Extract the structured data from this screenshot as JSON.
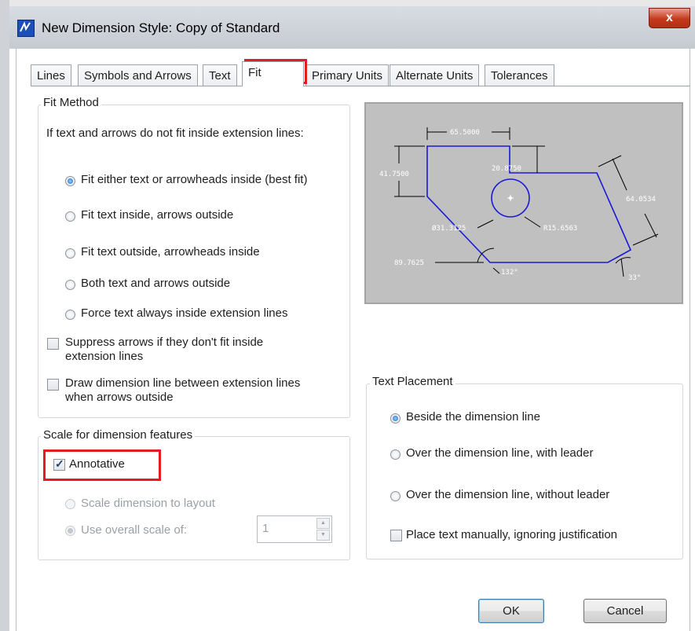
{
  "window": {
    "title": "New Dimension Style: Copy of Standard",
    "close_label": "x"
  },
  "tabs": [
    "Lines",
    "Symbols and Arrows",
    "Text",
    "Fit",
    "Primary Units",
    "Alternate Units",
    "Tolerances"
  ],
  "active_tab": "Fit",
  "fit_method": {
    "title": "Fit Method",
    "description": "If text and arrows do not fit inside extension lines:",
    "options": [
      {
        "label": "Fit either text or arrowheads inside (best fit)",
        "selected": true
      },
      {
        "label": "Fit text inside, arrows outside",
        "selected": false
      },
      {
        "label": "Fit text outside, arrowheads inside",
        "selected": false
      },
      {
        "label": "Both text and arrows outside",
        "selected": false
      },
      {
        "label": "Force text always inside extension lines",
        "selected": false
      }
    ],
    "suppress_arrows": {
      "line1": "Suppress arrows if they don't fit inside",
      "line2": "extension lines",
      "checked": false
    },
    "draw_dimension_line": {
      "line1": "Draw dimension line between extension lines",
      "line2": "when arrows outside",
      "checked": false
    }
  },
  "scale": {
    "title": "Scale for dimension features",
    "annotative": {
      "label": "Annotative",
      "checked": true
    },
    "scale_to_layout": {
      "label": "Scale dimension to layout",
      "selected": false,
      "enabled": false
    },
    "overall_scale": {
      "label": "Use overall scale of:",
      "selected": true,
      "enabled": false,
      "value": "1"
    }
  },
  "preview": {
    "labels": [
      "65.5000",
      "41.7500",
      "20.8750",
      "64.0534",
      "Ø31.3125",
      "R15.6563",
      "89.7625",
      "132°",
      "33°"
    ],
    "line_color": "#1a1ad6",
    "background": "#c0c0c0"
  },
  "text_placement": {
    "title": "Text Placement",
    "options": [
      {
        "label": "Beside the dimension line",
        "selected": true
      },
      {
        "label": "Over the dimension line, with leader",
        "selected": false
      },
      {
        "label": "Over the dimension line, without leader",
        "selected": false
      }
    ],
    "place_manually": {
      "label": "Place text manually, ignoring justification",
      "checked": false
    }
  },
  "buttons": {
    "ok": "OK",
    "cancel": "Cancel"
  },
  "colors": {
    "highlight": "#e31b23",
    "accent": "#1d64c4"
  }
}
